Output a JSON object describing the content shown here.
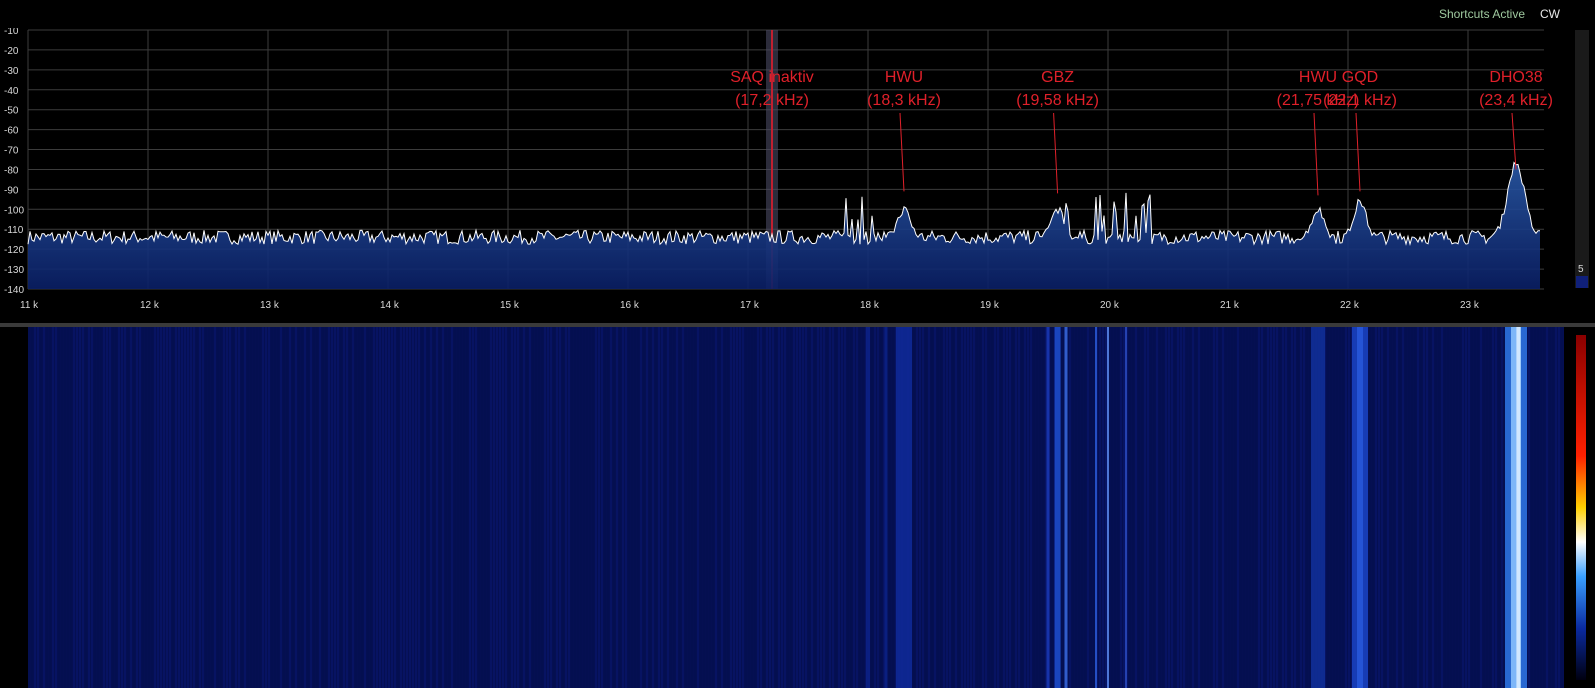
{
  "header": {
    "shortcuts_label": "Shortcuts Active",
    "mode_label": "CW"
  },
  "side_gain_label": "5",
  "colors": {
    "background": "#000000",
    "grid": "#3c3c3c",
    "trace": "#ffffff",
    "fill": "#0a1f66",
    "annotation": "#e0202a",
    "waterfall_base": "#050f52"
  },
  "markers": [
    {
      "name": "vfo-marker",
      "freq_khz": 17.2,
      "color": "#c02030"
    }
  ],
  "chart_data": {
    "type": "line",
    "xlim": [
      11.0,
      23.8
    ],
    "ylim": [
      -140,
      -10
    ],
    "x_ticks": [
      {
        "value": 11,
        "label": "11 k"
      },
      {
        "value": 12,
        "label": "12 k"
      },
      {
        "value": 13,
        "label": "13 k"
      },
      {
        "value": 14,
        "label": "14 k"
      },
      {
        "value": 15,
        "label": "15 k"
      },
      {
        "value": 16,
        "label": "16 k"
      },
      {
        "value": 17,
        "label": "17 k"
      },
      {
        "value": 18,
        "label": "18 k"
      },
      {
        "value": 19,
        "label": "19 k"
      },
      {
        "value": 20,
        "label": "20 k"
      },
      {
        "value": 21,
        "label": "21 k"
      },
      {
        "value": 22,
        "label": "22 k"
      },
      {
        "value": 23,
        "label": "23 k"
      }
    ],
    "y_ticks": [
      {
        "value": -10,
        "label": "-10"
      },
      {
        "value": -20,
        "label": "-20"
      },
      {
        "value": -30,
        "label": "-30"
      },
      {
        "value": -40,
        "label": "-40"
      },
      {
        "value": -50,
        "label": "-50"
      },
      {
        "value": -60,
        "label": "-60"
      },
      {
        "value": -70,
        "label": "-70"
      },
      {
        "value": -80,
        "label": "-80"
      },
      {
        "value": -90,
        "label": "-90"
      },
      {
        "value": -100,
        "label": "-100"
      },
      {
        "value": -110,
        "label": "-110"
      },
      {
        "value": -120,
        "label": "-120"
      },
      {
        "value": -130,
        "label": "-130"
      },
      {
        "value": -140,
        "label": "-140"
      }
    ],
    "noise_floor_db": -114,
    "signals": [
      {
        "freq_khz": 18.3,
        "peak_db": -100
      },
      {
        "freq_khz": 19.58,
        "peak_db": -100
      },
      {
        "freq_khz": 21.75,
        "peak_db": -100
      },
      {
        "freq_khz": 22.1,
        "peak_db": -96
      },
      {
        "freq_khz": 23.4,
        "peak_db": -77
      }
    ],
    "annotations": [
      {
        "line1": "SAQ inaktiv",
        "line2": "(17,2 kHz)",
        "freq_khz": 17.2,
        "pointer_db": null
      },
      {
        "line1": "HWU",
        "line2": "(18,3 kHz)",
        "freq_khz": 18.3,
        "pointer_db": -91
      },
      {
        "line1": "GBZ",
        "line2": "(19,58 kHz)",
        "freq_khz": 19.58,
        "pointer_db": -92
      },
      {
        "line1": "HWU",
        "line2": "(21,75 kHz)",
        "freq_khz": 21.75,
        "pointer_db": -93
      },
      {
        "line1": "GQD",
        "line2": "(22,1 kHz)",
        "freq_khz": 22.1,
        "pointer_db": -91
      },
      {
        "line1": "DHO38",
        "line2": "(23,4 kHz)",
        "freq_khz": 23.4,
        "pointer_db": -80
      }
    ]
  }
}
